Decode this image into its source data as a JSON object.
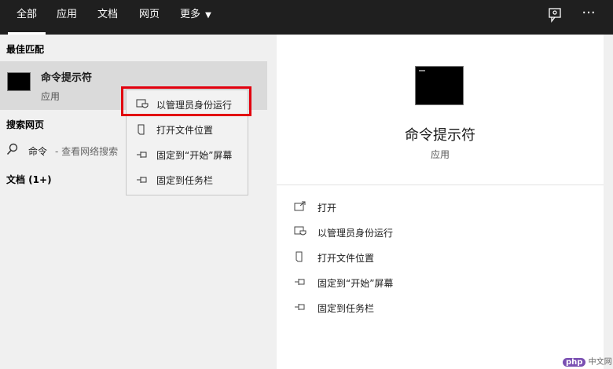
{
  "tabs": [
    {
      "label": "全部"
    },
    {
      "label": "应用"
    },
    {
      "label": "文档"
    },
    {
      "label": "网页"
    },
    {
      "label": "更多"
    }
  ],
  "icons": {
    "feedback": "feedback-icon",
    "more": "more-icon",
    "dropdown": "chevron-down-icon"
  },
  "left": {
    "best_match_heading": "最佳匹配",
    "best_match": {
      "title": "命令提示符",
      "subtitle": "应用"
    },
    "web_heading": "搜索网页",
    "web_result": {
      "query": "命令",
      "suffix": "- 查看网络搜索"
    },
    "docs_heading": "文档 (1+)"
  },
  "context_menu": {
    "items": [
      {
        "label": "以管理员身份运行",
        "icon": "shield-icon"
      },
      {
        "label": "打开文件位置",
        "icon": "file-icon"
      },
      {
        "label": "固定到“开始”屏幕",
        "icon": "pin-icon"
      },
      {
        "label": "固定到任务栏",
        "icon": "pin-icon"
      }
    ],
    "highlight_color": "#e2000e"
  },
  "preview": {
    "title": "命令提示符",
    "subtitle": "应用",
    "actions": [
      {
        "label": "打开",
        "icon": "open-icon"
      },
      {
        "label": "以管理员身份运行",
        "icon": "shield-icon"
      },
      {
        "label": "打开文件位置",
        "icon": "file-icon"
      },
      {
        "label": "固定到“开始”屏幕",
        "icon": "pin-icon"
      },
      {
        "label": "固定到任务栏",
        "icon": "pin-icon"
      }
    ]
  },
  "watermark": {
    "logo": "php",
    "text": "中文网"
  }
}
